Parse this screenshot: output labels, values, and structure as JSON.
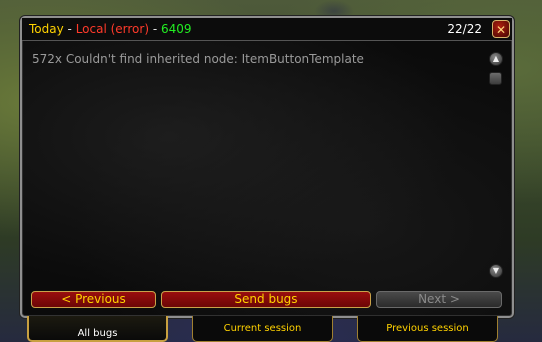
{
  "window": {
    "title_prefix": "Today",
    "title_sep1": " - ",
    "title_error": "Local (error)",
    "title_sep2": " - ",
    "title_count": "6409",
    "pager": "22/22",
    "close_glyph": "✕"
  },
  "error": {
    "message": "572x Couldn't find inherited node: ItemButtonTemplate"
  },
  "scroll": {
    "up_glyph": "▲",
    "down_glyph": "▼"
  },
  "buttons": {
    "previous": "< Previous",
    "send": "Send bugs",
    "next": "Next >"
  },
  "tabs": [
    {
      "label": "All bugs"
    },
    {
      "label": "Current session"
    },
    {
      "label": "Previous session"
    }
  ],
  "colors": {
    "title_date": "#ffd200",
    "title_error": "#ff3a2a",
    "title_count": "#22ee22",
    "button_red": "#9a0e0e",
    "gold_border": "#c9a24a"
  },
  "icons": [
    "close-icon",
    "scroll-up-icon",
    "scroll-down-icon"
  ]
}
